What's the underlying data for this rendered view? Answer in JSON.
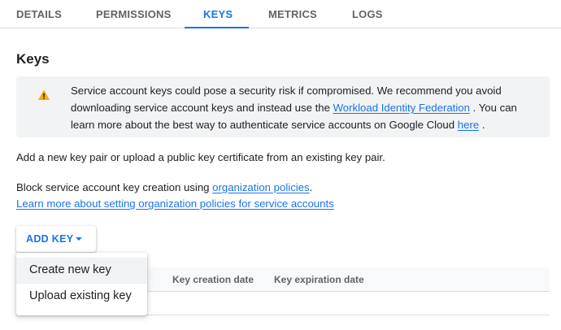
{
  "tabs": [
    {
      "label": "DETAILS"
    },
    {
      "label": "PERMISSIONS"
    },
    {
      "label": "KEYS"
    },
    {
      "label": "METRICS"
    },
    {
      "label": "LOGS"
    }
  ],
  "active_tab": "KEYS",
  "page_title": "Keys",
  "banner": {
    "icon": "warning-icon",
    "text_before": "Service account keys could pose a security risk if compromised. We recommend you avoid downloading service account keys and instead use the ",
    "link1": "Workload Identity Federation",
    "text_middle": " . You can learn more about the best way to authenticate service accounts on Google Cloud ",
    "link2": "here",
    "text_after": " ."
  },
  "intro_text": "Add a new key pair or upload a public key certificate from an existing key pair.",
  "policy": {
    "text": "Block service account key creation using ",
    "link1": "organization policies",
    "period": ".",
    "link2": "Learn more about setting organization policies for service accounts"
  },
  "add_key_button": "ADD KEY",
  "dropdown_menu": [
    {
      "label": "Create new key"
    },
    {
      "label": "Upload existing key"
    }
  ],
  "table": {
    "headers": [
      "Key creation date",
      "Key expiration date"
    ]
  },
  "colors": {
    "accent": "#1a73e8",
    "warning": "#f9ab00",
    "banner_bg": "#f1f3f4"
  }
}
